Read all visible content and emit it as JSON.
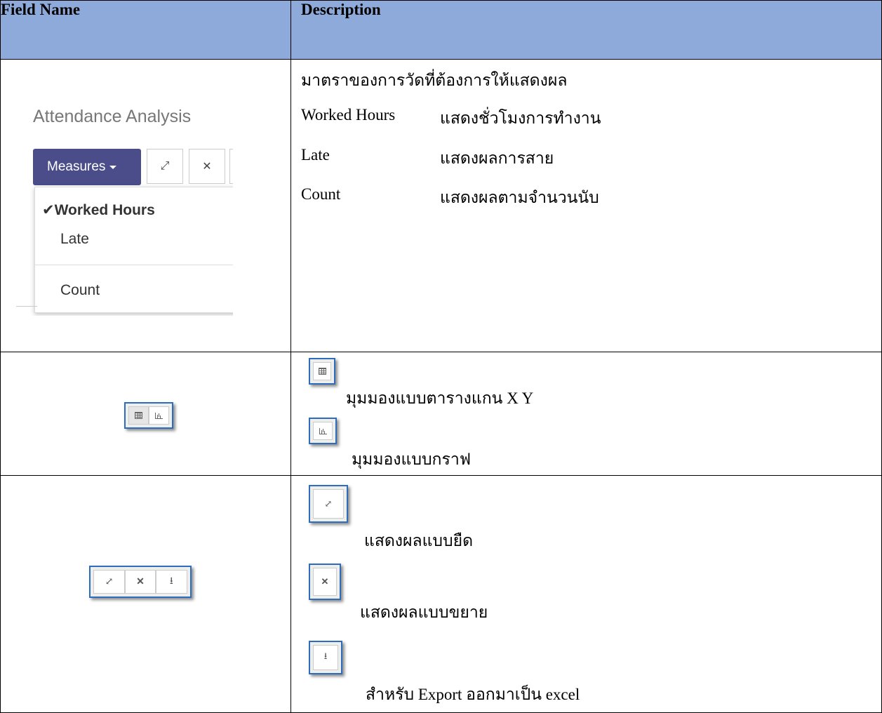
{
  "header": {
    "field_name": "Field Name",
    "description": "Description"
  },
  "row1": {
    "screenshot": {
      "title": "Attendance Analysis",
      "measures_label": "Measures",
      "menu_items": [
        "Worked Hours",
        "Late",
        "Count"
      ],
      "checked_item": "Worked Hours",
      "check_glyph": "✔"
    },
    "desc_title": "มาตราของการวัดที่ต้องการให้แสดงผล",
    "desc_items": [
      {
        "label": "Worked Hours",
        "text": "แสดงชั่วโมงการทำงาน"
      },
      {
        "label": "Late",
        "text": "แสดงผลการสาย"
      },
      {
        "label": "Count",
        "text": "แสดงผลตามจำนวนนับ"
      }
    ]
  },
  "row2": {
    "desc_pivot": "มุมมองแบบตารางแกน X Y",
    "desc_graph": "มุมมองแบบกราฟ"
  },
  "row3": {
    "desc_expand": "แสดงผลแบบยืด",
    "desc_fullscreen": "แสดงผลแบบขยาย",
    "desc_export": "สำหรับ Export ออกมาเป็น excel"
  },
  "icons": {
    "expand": "⤢",
    "fullscreen": "✕",
    "download": "⭳"
  }
}
